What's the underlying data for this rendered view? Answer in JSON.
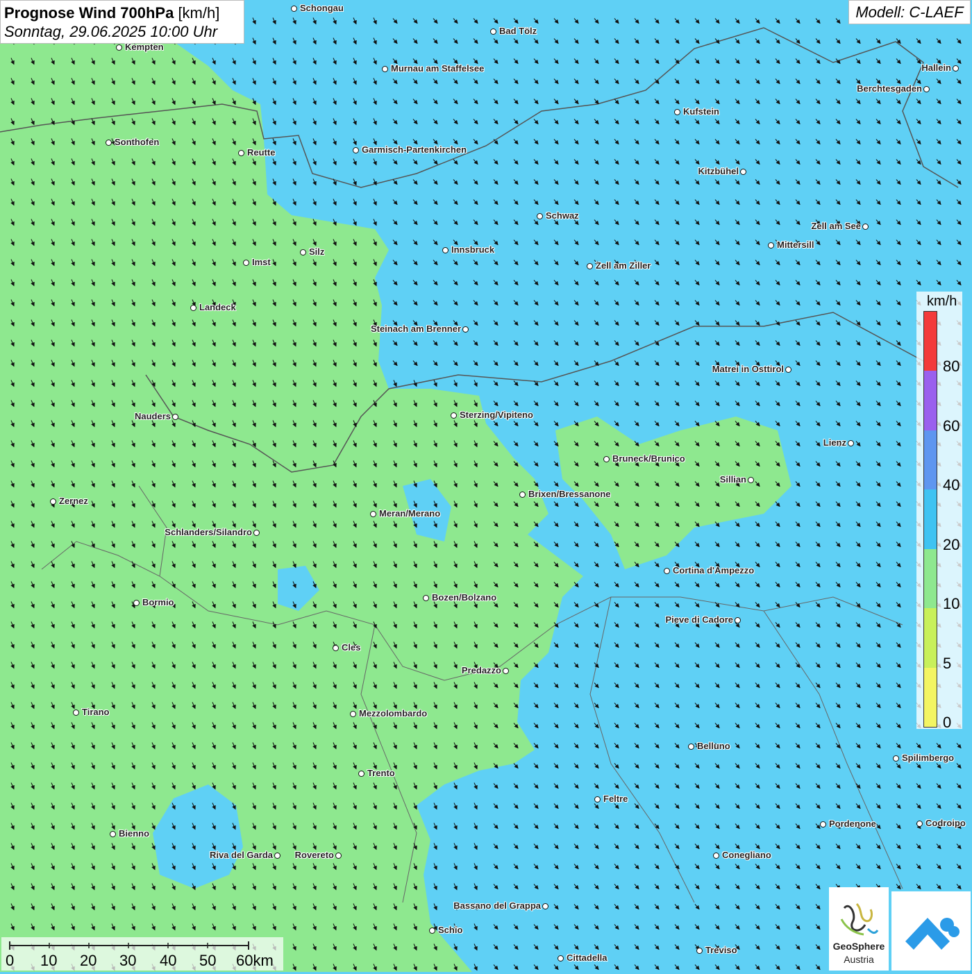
{
  "header": {
    "title_bold": "Prognose Wind 700hPa",
    "title_unit": "[km/h]",
    "date": "Sonntag, 29.06.2025 10:00 Uhr",
    "model": "Modell: C-LAEF"
  },
  "legend": {
    "unit": "km/h",
    "classes": [
      {
        "from": 0,
        "to": 5,
        "color": "#f3f562"
      },
      {
        "from": 5,
        "to": 10,
        "color": "#c8f05a"
      },
      {
        "from": 10,
        "to": 20,
        "color": "#8ee88f"
      },
      {
        "from": 20,
        "to": 40,
        "color": "#3fc3f2"
      },
      {
        "from": 40,
        "to": 60,
        "color": "#5e96f0"
      },
      {
        "from": 60,
        "to": 80,
        "color": "#9a60ee"
      },
      {
        "from": 80,
        "to": 100,
        "color": "#f33b3b"
      }
    ],
    "tick_labels": [
      "0",
      "5",
      "10",
      "20",
      "40",
      "60",
      "80"
    ]
  },
  "scalebar": {
    "labels": [
      "0",
      "10",
      "20",
      "30",
      "40",
      "50",
      "60km"
    ]
  },
  "logo": {
    "line1": "GeoSphere",
    "line2": "Austria"
  },
  "wind": {
    "direction": "north-west",
    "arrow_icon": "wind-arrow-icon"
  },
  "colors": {
    "slow_zone": "#8ee88f",
    "fast_zone": "#5fd0f5",
    "border": "#555555"
  },
  "cities": [
    {
      "name": "Schongau",
      "side": "right"
    },
    {
      "name": "Bad Tölz",
      "side": "right"
    },
    {
      "name": "Kempten",
      "side": "right"
    },
    {
      "name": "Murnau am Staffelsee",
      "side": "right"
    },
    {
      "name": "Hallein",
      "side": "left"
    },
    {
      "name": "Berchtesgaden",
      "side": "left"
    },
    {
      "name": "Kufstein",
      "side": "right"
    },
    {
      "name": "Sonthofen",
      "side": "right"
    },
    {
      "name": "Reutte",
      "side": "right"
    },
    {
      "name": "Garmisch-Partenkirchen",
      "side": "right"
    },
    {
      "name": "Kitzbühel",
      "side": "left"
    },
    {
      "name": "Schwaz",
      "side": "right"
    },
    {
      "name": "Zell am See",
      "side": "left"
    },
    {
      "name": "Mittersill",
      "side": "right"
    },
    {
      "name": "Innsbruck",
      "side": "right"
    },
    {
      "name": "Silz",
      "side": "right"
    },
    {
      "name": "Imst",
      "side": "right"
    },
    {
      "name": "Zell am Ziller",
      "side": "right"
    },
    {
      "name": "Landeck",
      "side": "right"
    },
    {
      "name": "Steinach am Brenner",
      "side": "left"
    },
    {
      "name": "Matrei in Osttirol",
      "side": "left"
    },
    {
      "name": "Nauders",
      "side": "left"
    },
    {
      "name": "Sterzing/Vipiteno",
      "side": "right"
    },
    {
      "name": "Lienz",
      "side": "left"
    },
    {
      "name": "Bruneck/Brunico",
      "side": "right"
    },
    {
      "name": "Sillian",
      "side": "left"
    },
    {
      "name": "Brixen/Bressanone",
      "side": "right"
    },
    {
      "name": "Zernez",
      "side": "right"
    },
    {
      "name": "Meran/Merano",
      "side": "right"
    },
    {
      "name": "Schlanders/Silandro",
      "side": "left"
    },
    {
      "name": "Cortina d'Ampezzo",
      "side": "right"
    },
    {
      "name": "Bozen/Bolzano",
      "side": "right"
    },
    {
      "name": "Bormio",
      "side": "right"
    },
    {
      "name": "Pieve di Cadore",
      "side": "left"
    },
    {
      "name": "Cles",
      "side": "right"
    },
    {
      "name": "Predazzo",
      "side": "left"
    },
    {
      "name": "Tirano",
      "side": "right"
    },
    {
      "name": "Mezzolombardo",
      "side": "right"
    },
    {
      "name": "Belluno",
      "side": "right"
    },
    {
      "name": "Spilimbergo",
      "side": "right"
    },
    {
      "name": "Trento",
      "side": "right"
    },
    {
      "name": "Feltre",
      "side": "right"
    },
    {
      "name": "Pordenone",
      "side": "right"
    },
    {
      "name": "Codroipo",
      "side": "right"
    },
    {
      "name": "Bienno",
      "side": "right"
    },
    {
      "name": "Riva del Garda",
      "side": "left"
    },
    {
      "name": "Rovereto",
      "side": "left"
    },
    {
      "name": "Conegliano",
      "side": "right"
    },
    {
      "name": "Bassano del Grappa",
      "side": "left"
    },
    {
      "name": "Schio",
      "side": "right"
    },
    {
      "name": "Treviso",
      "side": "right"
    },
    {
      "name": "Cittadella",
      "side": "right"
    }
  ]
}
